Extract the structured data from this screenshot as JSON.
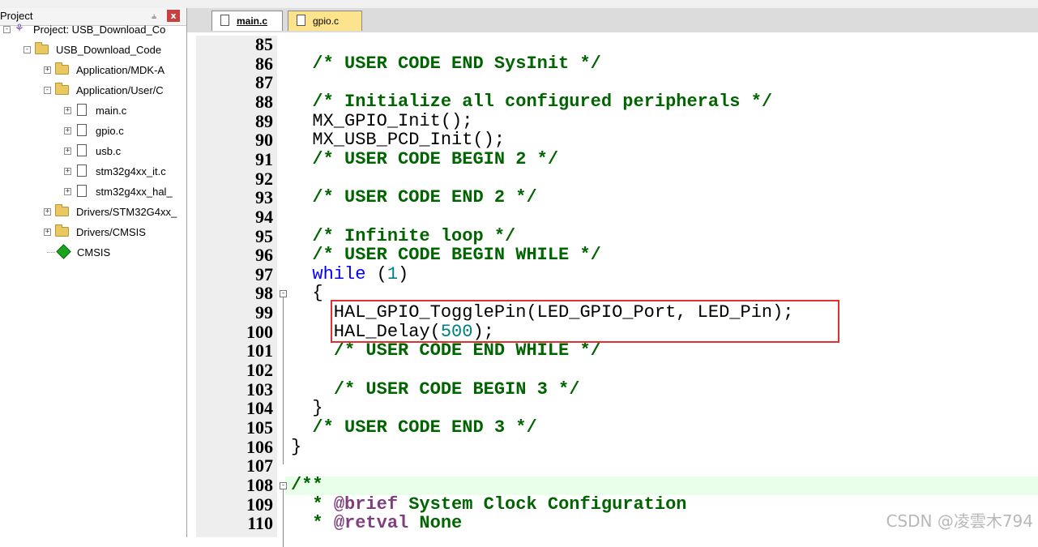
{
  "panel": {
    "title": "Project",
    "pin_icon": "pin-icon",
    "close_icon": "close-icon",
    "close_glyph": "x",
    "tree": [
      {
        "label": "Project: USB_Download_Co",
        "icon": "project-icon",
        "expander": "-"
      },
      {
        "label": "USB_Download_Code",
        "icon": "target-folder-icon",
        "expander": "-"
      },
      {
        "label": "Application/MDK-A",
        "icon": "folder-icon",
        "expander": "+"
      },
      {
        "label": "Application/User/C",
        "icon": "folder-open-icon",
        "expander": "-"
      },
      {
        "label": "main.c",
        "icon": "file-icon",
        "expander": "+"
      },
      {
        "label": "gpio.c",
        "icon": "file-icon",
        "expander": "+"
      },
      {
        "label": "usb.c",
        "icon": "file-icon",
        "expander": "+"
      },
      {
        "label": "stm32g4xx_it.c",
        "icon": "file-icon",
        "expander": "+"
      },
      {
        "label": "stm32g4xx_hal_",
        "icon": "file-icon",
        "expander": "+"
      },
      {
        "label": "Drivers/STM32G4xx_",
        "icon": "folder-icon",
        "expander": "+"
      },
      {
        "label": "Drivers/CMSIS",
        "icon": "folder-icon",
        "expander": "+"
      },
      {
        "label": "CMSIS",
        "icon": "green-diamond-icon",
        "expander": ""
      }
    ]
  },
  "tabs": [
    {
      "label": "main.c",
      "active": true
    },
    {
      "label": "gpio.c",
      "active": false
    }
  ],
  "code_lines": [
    {
      "num": "85",
      "segments": []
    },
    {
      "num": "86",
      "segments": [
        {
          "t": "  "
        },
        {
          "t": "/* USER CODE END SysInit */",
          "c": "comment"
        }
      ]
    },
    {
      "num": "87",
      "segments": []
    },
    {
      "num": "88",
      "segments": [
        {
          "t": "  "
        },
        {
          "t": "/* Initialize all configured peripherals */",
          "c": "comment"
        }
      ]
    },
    {
      "num": "89",
      "segments": [
        {
          "t": "  MX_GPIO_Init();"
        }
      ]
    },
    {
      "num": "90",
      "segments": [
        {
          "t": "  MX_USB_PCD_Init();"
        }
      ]
    },
    {
      "num": "91",
      "segments": [
        {
          "t": "  "
        },
        {
          "t": "/* USER CODE BEGIN 2 */",
          "c": "comment"
        }
      ]
    },
    {
      "num": "92",
      "segments": []
    },
    {
      "num": "93",
      "segments": [
        {
          "t": "  "
        },
        {
          "t": "/* USER CODE END 2 */",
          "c": "comment"
        }
      ]
    },
    {
      "num": "94",
      "segments": []
    },
    {
      "num": "95",
      "segments": [
        {
          "t": "  "
        },
        {
          "t": "/* Infinite loop */",
          "c": "comment"
        }
      ]
    },
    {
      "num": "96",
      "segments": [
        {
          "t": "  "
        },
        {
          "t": "/* USER CODE BEGIN WHILE */",
          "c": "comment"
        }
      ]
    },
    {
      "num": "97",
      "segments": [
        {
          "t": "  "
        },
        {
          "t": "while",
          "c": "kw"
        },
        {
          "t": " ("
        },
        {
          "t": "1",
          "c": "num"
        },
        {
          "t": ")"
        }
      ]
    },
    {
      "num": "98",
      "segments": [
        {
          "t": "  {"
        }
      ]
    },
    {
      "num": "99",
      "segments": [
        {
          "t": "    HAL_GPIO_TogglePin(LED_GPIO_Port, LED_Pin);"
        }
      ]
    },
    {
      "num": "100",
      "segments": [
        {
          "t": "    HAL_Delay("
        },
        {
          "t": "500",
          "c": "num"
        },
        {
          "t": ");"
        }
      ]
    },
    {
      "num": "101",
      "segments": [
        {
          "t": "    "
        },
        {
          "t": "/* USER CODE END WHILE */",
          "c": "comment"
        }
      ]
    },
    {
      "num": "102",
      "segments": []
    },
    {
      "num": "103",
      "segments": [
        {
          "t": "    "
        },
        {
          "t": "/* USER CODE BEGIN 3 */",
          "c": "comment"
        }
      ]
    },
    {
      "num": "104",
      "segments": [
        {
          "t": "  }"
        }
      ]
    },
    {
      "num": "105",
      "segments": [
        {
          "t": "  "
        },
        {
          "t": "/* USER CODE END 3 */",
          "c": "comment"
        }
      ]
    },
    {
      "num": "106",
      "segments": [
        {
          "t": "}"
        }
      ]
    },
    {
      "num": "107",
      "segments": []
    },
    {
      "num": "108",
      "segments": [
        {
          "t": "/**",
          "c": "doc"
        }
      ]
    },
    {
      "num": "109",
      "segments": [
        {
          "t": "  "
        },
        {
          "t": "* ",
          "c": "doc"
        },
        {
          "t": "@brief",
          "c": "doctag"
        },
        {
          "t": " System Clock Configuration",
          "c": "doc"
        }
      ]
    },
    {
      "num": "110",
      "segments": [
        {
          "t": "  "
        },
        {
          "t": "* ",
          "c": "doc"
        },
        {
          "t": "@retval",
          "c": "doctag"
        },
        {
          "t": " None",
          "c": "doc"
        }
      ]
    }
  ],
  "fold_markers": [
    {
      "line": "98",
      "symbol": "-"
    },
    {
      "line": "108",
      "symbol": "-"
    }
  ],
  "watermark": "CSDN @凌雲木794",
  "colors": {
    "comment": "#006400",
    "keyword": "#0000ff",
    "number": "#008080",
    "doc_tag": "#7f3f7f",
    "highlight_box": "#e03030",
    "gpio_tab": "#fde38c"
  }
}
